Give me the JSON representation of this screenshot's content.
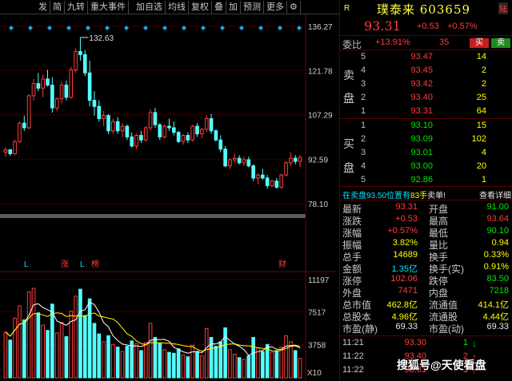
{
  "toolbar": {
    "buttons": [
      "发",
      "简",
      "九转",
      "重大事件",
      "加自选",
      "均线",
      "复权",
      "叠",
      "加",
      "预测",
      "更多",
      "⚙"
    ]
  },
  "stock": {
    "tag_r": "R",
    "name_code": "璞泰来 603659",
    "exchange_tag": "陆",
    "price": "93.31",
    "change": "+0.53",
    "change_pct": "+0.57%"
  },
  "orderbook": {
    "weibi_label": "委比",
    "weibi_value": "+13.91%",
    "weibi_diff": "35",
    "buy_btn": "买",
    "sell_btn": "卖",
    "sell_side_label": [
      "卖",
      "盘"
    ],
    "buy_side_label": [
      "买",
      "盘"
    ],
    "asks": [
      {
        "lvl": "5",
        "price": "93.47",
        "vol": "14"
      },
      {
        "lvl": "4",
        "price": "93.45",
        "vol": "2"
      },
      {
        "lvl": "3",
        "price": "93.42",
        "vol": "2"
      },
      {
        "lvl": "2",
        "price": "93.40",
        "vol": "25"
      },
      {
        "lvl": "1",
        "price": "93.31",
        "vol": "64"
      }
    ],
    "bids": [
      {
        "lvl": "1",
        "price": "93.10",
        "vol": "15"
      },
      {
        "lvl": "2",
        "price": "93.09",
        "vol": "102"
      },
      {
        "lvl": "3",
        "price": "93.01",
        "vol": "4"
      },
      {
        "lvl": "4",
        "price": "93.00",
        "vol": "20"
      },
      {
        "lvl": "5",
        "price": "92.86",
        "vol": "1"
      }
    ],
    "notice_a": "在卖盘93.50位置有",
    "notice_b": "83手",
    "notice_c": "卖单!",
    "notice_link": "查看详细"
  },
  "stats": [
    {
      "l1": "最新",
      "v1": "93.31",
      "c1": "red",
      "l2": "开盘",
      "v2": "91.00",
      "c2": "green"
    },
    {
      "l1": "涨跌",
      "v1": "+0.53",
      "c1": "red",
      "l2": "最高",
      "v2": "93.64",
      "c2": "red"
    },
    {
      "l1": "涨幅",
      "v1": "+0.57%",
      "c1": "red",
      "l2": "最低",
      "v2": "90.10",
      "c2": "green"
    },
    {
      "l1": "振幅",
      "v1": "3.82%",
      "c1": "yellow",
      "l2": "量比",
      "v2": "0.94",
      "c2": "yellow"
    },
    {
      "l1": "总手",
      "v1": "14689",
      "c1": "yellow",
      "l2": "换手",
      "v2": "0.33%",
      "c2": "yellow"
    },
    {
      "l1": "金额",
      "v1": "1.35亿",
      "c1": "cyan",
      "l2": "换手(实)",
      "v2": "0.91%",
      "c2": "yellow"
    },
    {
      "l1": "涨停",
      "v1": "102.06",
      "c1": "red",
      "l2": "跌停",
      "v2": "83.50",
      "c2": "green"
    },
    {
      "l1": "外盘",
      "v1": "7471",
      "c1": "red",
      "l2": "内盘",
      "v2": "7218",
      "c2": "green"
    },
    {
      "l1": "总市值",
      "v1": "462.8亿",
      "c1": "yellow",
      "l2": "流通值",
      "v2": "414.1亿",
      "c2": "yellow"
    },
    {
      "l1": "总股本",
      "v1": "4.96亿",
      "c1": "yellow",
      "l2": "流通股",
      "v2": "4.44亿",
      "c2": "yellow"
    },
    {
      "l1": "市盈(静)",
      "v1": "69.33",
      "c1": "white",
      "l2": "市盈(动)",
      "v2": "69.33",
      "c2": "white"
    }
  ],
  "ticks": [
    {
      "time": "11:21",
      "price": "93.30",
      "vol": "1",
      "dir": "down"
    },
    {
      "time": "11:22",
      "price": "93.40",
      "vol": "2",
      "dir": "up"
    },
    {
      "time": "11:22",
      "price": "93.31",
      "vol": "1",
      "dir": "up"
    }
  ],
  "watermark": "搜狐号@天使看盘",
  "chart": {
    "price_labels": [
      "136.27",
      "121.78",
      "107.29",
      "92.59",
      "78.10"
    ],
    "vol_labels": [
      "11197",
      "7517",
      "3758",
      "X10"
    ],
    "high_annot": "132.63",
    "event_markers": [
      "L",
      "涨",
      "L",
      "榜",
      "财"
    ],
    "colors": {
      "up": "#ff3c3c",
      "down": "#54ffff",
      "ma1": "#ffffff",
      "ma2": "#ffff00",
      "grid": "#7a0000"
    }
  },
  "chart_data": {
    "type": "candlestick",
    "price_ylim": [
      78.1,
      136.27
    ],
    "vol_ylim": [
      0,
      11197
    ],
    "candles": [
      [
        95.0,
        96.5,
        93.5,
        95.8,
        5200
      ],
      [
        95.8,
        96.0,
        93.8,
        94.5,
        4300
      ],
      [
        94.5,
        99.0,
        94.0,
        98.5,
        6800
      ],
      [
        98.5,
        105.0,
        98.0,
        104.5,
        8200
      ],
      [
        104.5,
        107.0,
        102.0,
        103.0,
        6600
      ],
      [
        103.0,
        114.0,
        102.5,
        113.5,
        9800
      ],
      [
        113.5,
        119.0,
        112.0,
        117.5,
        10200
      ],
      [
        117.5,
        121.0,
        115.0,
        116.0,
        7400
      ],
      [
        116.0,
        120.5,
        113.0,
        119.0,
        6000
      ],
      [
        119.0,
        122.0,
        116.5,
        117.0,
        5400
      ],
      [
        117.0,
        119.5,
        108.0,
        109.5,
        8400
      ],
      [
        109.5,
        113.0,
        108.5,
        112.5,
        5100
      ],
      [
        112.5,
        118.0,
        111.0,
        117.0,
        6300
      ],
      [
        117.0,
        118.5,
        112.0,
        113.0,
        4700
      ],
      [
        113.0,
        123.0,
        112.5,
        122.0,
        7600
      ],
      [
        122.0,
        129.0,
        121.0,
        128.0,
        9300
      ],
      [
        128.0,
        132.63,
        125.0,
        127.0,
        10100
      ],
      [
        127.0,
        128.5,
        120.0,
        121.0,
        7100
      ],
      [
        121.0,
        125.0,
        110.0,
        112.0,
        9000
      ],
      [
        112.0,
        115.0,
        107.0,
        110.0,
        6200
      ],
      [
        110.0,
        112.0,
        105.0,
        106.0,
        5000
      ],
      [
        106.0,
        108.5,
        103.5,
        107.0,
        4100
      ],
      [
        107.0,
        107.5,
        101.0,
        102.0,
        4800
      ],
      [
        102.0,
        106.0,
        101.0,
        105.0,
        3800
      ],
      [
        105.0,
        106.5,
        101.0,
        102.0,
        3500
      ],
      [
        102.0,
        104.5,
        100.0,
        103.5,
        3000
      ],
      [
        103.5,
        104.0,
        99.0,
        100.0,
        3600
      ],
      [
        100.0,
        101.5,
        96.5,
        97.0,
        4200
      ],
      [
        97.0,
        101.0,
        96.0,
        100.5,
        3900
      ],
      [
        100.5,
        102.0,
        98.0,
        99.0,
        3100
      ],
      [
        99.0,
        103.5,
        98.5,
        103.0,
        4000
      ],
      [
        103.0,
        109.0,
        102.0,
        108.0,
        6200
      ],
      [
        108.0,
        109.5,
        103.0,
        104.0,
        4600
      ],
      [
        104.0,
        104.5,
        99.0,
        100.0,
        3900
      ],
      [
        100.0,
        104.0,
        99.5,
        103.5,
        3200
      ],
      [
        103.5,
        106.0,
        102.0,
        103.0,
        2900
      ],
      [
        103.0,
        105.0,
        100.5,
        101.5,
        2800
      ],
      [
        101.5,
        102.0,
        98.0,
        98.5,
        3300
      ],
      [
        98.5,
        101.0,
        97.5,
        100.5,
        2600
      ],
      [
        100.5,
        101.5,
        98.0,
        99.0,
        2400
      ],
      [
        99.0,
        104.0,
        98.5,
        103.5,
        3700
      ],
      [
        103.5,
        104.5,
        100.0,
        101.0,
        3000
      ],
      [
        101.0,
        103.0,
        99.5,
        102.5,
        2500
      ],
      [
        102.5,
        107.0,
        101.5,
        106.0,
        5600
      ],
      [
        106.0,
        107.5,
        101.0,
        102.0,
        4600
      ],
      [
        102.0,
        102.5,
        98.5,
        99.0,
        3600
      ],
      [
        99.0,
        100.5,
        95.0,
        96.0,
        4100
      ],
      [
        96.0,
        97.0,
        90.0,
        90.5,
        5700
      ],
      [
        90.5,
        93.0,
        89.5,
        92.5,
        3200
      ],
      [
        92.5,
        94.5,
        91.5,
        93.0,
        2700
      ],
      [
        93.0,
        94.0,
        91.0,
        91.5,
        2300
      ],
      [
        91.5,
        93.5,
        90.5,
        92.5,
        2100
      ],
      [
        92.5,
        93.5,
        90.0,
        90.5,
        2500
      ],
      [
        90.5,
        91.0,
        85.5,
        86.5,
        4600
      ],
      [
        86.5,
        88.0,
        84.5,
        87.5,
        3400
      ],
      [
        87.5,
        89.5,
        86.0,
        86.5,
        3000
      ],
      [
        86.5,
        87.5,
        83.0,
        84.0,
        3800
      ],
      [
        84.0,
        86.0,
        83.5,
        85.5,
        2900
      ],
      [
        85.5,
        86.5,
        83.0,
        83.5,
        3100
      ],
      [
        83.5,
        88.0,
        83.0,
        87.5,
        3500
      ],
      [
        87.5,
        92.0,
        87.0,
        91.5,
        4800
      ],
      [
        91.5,
        95.0,
        90.5,
        93.0,
        4100
      ],
      [
        93.0,
        94.0,
        91.0,
        92.0,
        3100
      ],
      [
        92.0,
        94.0,
        90.1,
        93.31,
        2200
      ]
    ]
  }
}
